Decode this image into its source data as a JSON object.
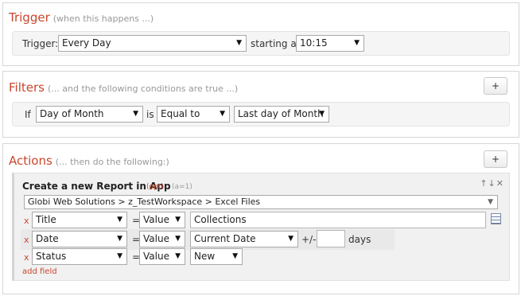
{
  "trigger": {
    "title": "Trigger",
    "subtitle": "(when this happens ...)",
    "trigger_label": "Trigger:",
    "trigger_value": "Every Day",
    "starting_label": "starting at",
    "time_value": "10:15"
  },
  "filters": {
    "title": "Filters",
    "subtitle": "(... and the following conditions are true ...)",
    "add_label": "+",
    "if_label": "If",
    "field_value": "Day of Month",
    "is_label": "is",
    "operator_value": "Equal to",
    "compare_value": "Last day of Month"
  },
  "actions": {
    "title": "Actions",
    "subtitle": "(... then do the following:)",
    "add_label": "+",
    "action": {
      "title": "Create a new Report in App",
      "opt_label": "(opt)",
      "a_label": "(a=1)",
      "controls": "↑↓✕",
      "path": "Globi Web Solutions > z_TestWorkspace > Excel Files",
      "rows": [
        {
          "remove": "x",
          "field": "Title",
          "eq": "=",
          "type": "Value",
          "value": "Collections"
        },
        {
          "remove": "x",
          "field": "Date",
          "eq": "=",
          "type": "Value",
          "value": "Current Date",
          "plusminus": "+/-",
          "offset": "",
          "unit": "days"
        },
        {
          "remove": "x",
          "field": "Status",
          "eq": "=",
          "type": "Value",
          "value": "New"
        }
      ],
      "add_field": "add field"
    }
  }
}
